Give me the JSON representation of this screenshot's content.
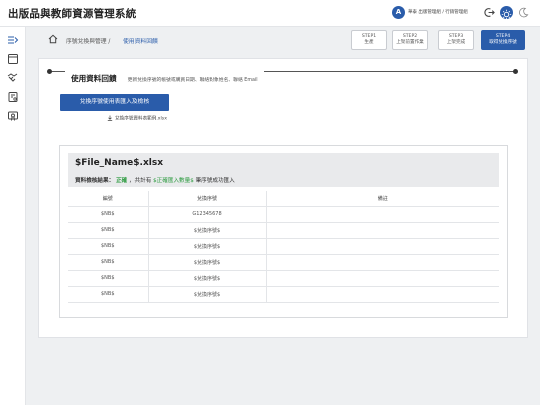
{
  "app": {
    "title": "出版品與教師資源管理系統",
    "user_initial": "A",
    "user_role": "華泰 出版管理組 / 行銷管理組"
  },
  "breadcrumb": {
    "items": [
      "序號兌換與管理 /",
      "使用資料回饋"
    ]
  },
  "steps": [
    {
      "step": "STEP1",
      "label": "生產"
    },
    {
      "step": "STEP2",
      "label": "上架前置作業"
    },
    {
      "step": "STEP3",
      "label": "上架完成"
    },
    {
      "step": "STEP4",
      "label": "取得兌換序號"
    }
  ],
  "section": {
    "title": "使用資料回饋",
    "description": "更新兌換序號的帳號或購買日期、聯絡對象姓名、聯絡 Email"
  },
  "import_button": "兌換序號使用表匯入及檢核",
  "download_link": "兌換序號資料表範例.xlsx",
  "result": {
    "file_name": "$File_Name$.xlsx",
    "check_label": "資料檢核結果：",
    "status": "正確",
    "summary_pre": "，共計有",
    "count": "$正確匯入數量$",
    "summary_post": "筆序號成功匯入"
  },
  "table": {
    "headers": [
      "編號",
      "兌換序號",
      "備註"
    ],
    "rows": [
      [
        "$NB$",
        "G12345678",
        ""
      ],
      [
        "$NB$",
        "$兌換序號$",
        ""
      ],
      [
        "$NB$",
        "$兌換序號$",
        ""
      ],
      [
        "$NB$",
        "$兌換序號$",
        ""
      ],
      [
        "$NB$",
        "$兌換序號$",
        ""
      ],
      [
        "$NB$",
        "$兌換序號$",
        ""
      ]
    ]
  },
  "colors": {
    "primary": "#2a5caa",
    "success": "#2b9a3e",
    "background": "#eef0f2"
  }
}
